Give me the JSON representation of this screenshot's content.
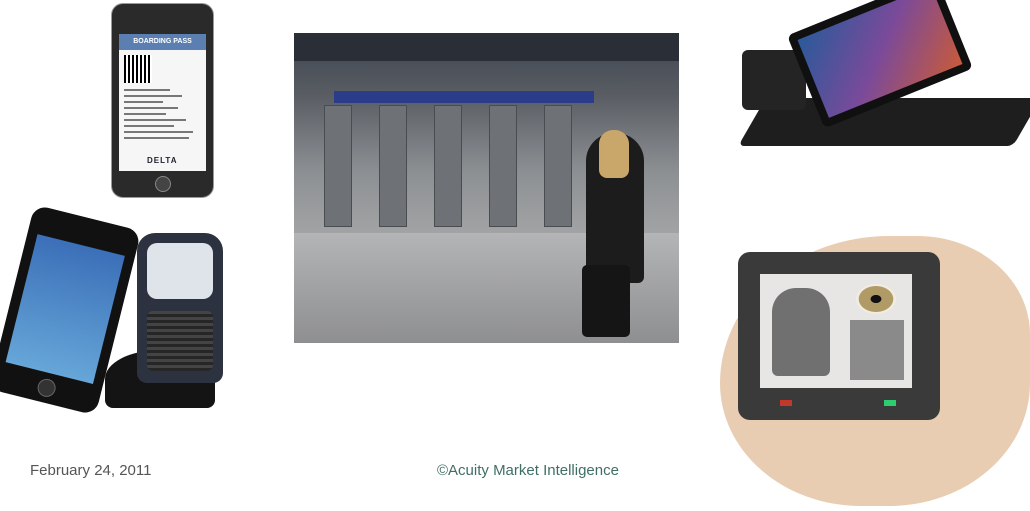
{
  "boarding_pass": {
    "header": "BOARDING PASS",
    "airline": "DELTA"
  },
  "footer": {
    "date": "February 24, 2011",
    "copyright": "©Acuity Market Intelligence"
  }
}
